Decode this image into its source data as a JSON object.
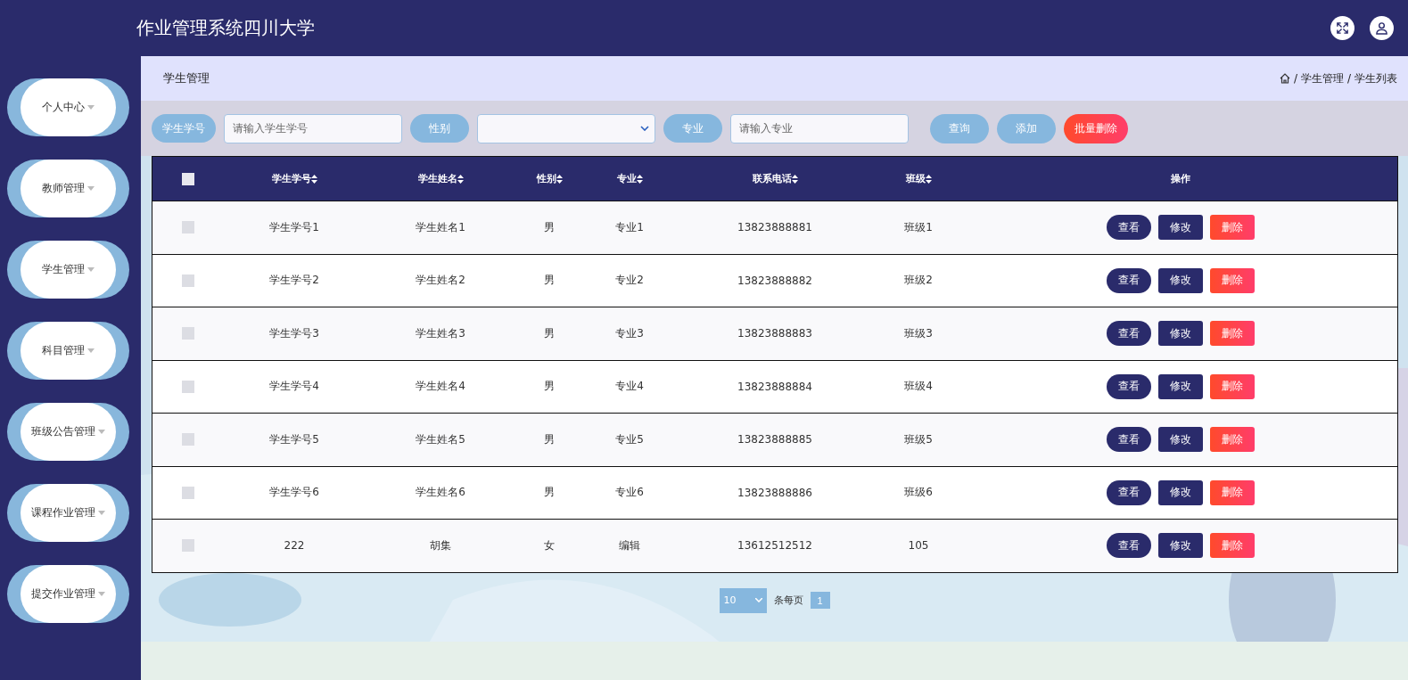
{
  "header": {
    "title": "作业管理系统四川大学"
  },
  "sidebar": {
    "items": [
      {
        "label": "个人中心",
        "expanded": false
      },
      {
        "label": "教师管理",
        "expanded": false
      },
      {
        "label": "学生管理",
        "expanded": false
      },
      {
        "label": "科目管理",
        "expanded": false
      },
      {
        "label": "班级公告管理",
        "expanded": false
      },
      {
        "label": "课程作业管理",
        "expanded": false
      },
      {
        "label": "提交作业管理",
        "expanded": false
      }
    ]
  },
  "page_title": "学生管理",
  "breadcrumb": [
    {
      "separator": "/",
      "label": "学生管理"
    },
    {
      "separator": "/",
      "label": "学生列表"
    }
  ],
  "search": {
    "fields": [
      {
        "kind": "input",
        "label": "学生学号",
        "placeholder": "请输入学生学号"
      },
      {
        "kind": "select",
        "label": "性别"
      },
      {
        "kind": "input",
        "label": "专业",
        "placeholder": "请输入专业"
      }
    ],
    "buttons": [
      {
        "label": "查询",
        "kind": "plain"
      },
      {
        "label": "添加",
        "kind": "plain"
      },
      {
        "label": "批量删除",
        "kind": "danger"
      }
    ]
  },
  "table": {
    "select_all_checked": false,
    "columns": [
      "学生学号",
      "学生姓名",
      "性别",
      "专业",
      "联系电话",
      "班级",
      "操作"
    ],
    "rows": [
      {
        "checked": false,
        "cells": [
          "学生学号1",
          "学生姓名1",
          "男",
          "专业1",
          "13823888881",
          "班级1"
        ],
        "actions": [
          {
            "label": "查看",
            "kind": "view"
          },
          {
            "label": "修改",
            "kind": "edit"
          },
          {
            "label": "删除",
            "kind": "delete"
          }
        ]
      },
      {
        "checked": false,
        "cells": [
          "学生学号2",
          "学生姓名2",
          "男",
          "专业2",
          "13823888882",
          "班级2"
        ],
        "actions": [
          {
            "label": "查看",
            "kind": "view"
          },
          {
            "label": "修改",
            "kind": "edit"
          },
          {
            "label": "删除",
            "kind": "delete"
          }
        ]
      },
      {
        "checked": false,
        "cells": [
          "学生学号3",
          "学生姓名3",
          "男",
          "专业3",
          "13823888883",
          "班级3"
        ],
        "actions": [
          {
            "label": "查看",
            "kind": "view"
          },
          {
            "label": "修改",
            "kind": "edit"
          },
          {
            "label": "删除",
            "kind": "delete"
          }
        ]
      },
      {
        "checked": false,
        "cells": [
          "学生学号4",
          "学生姓名4",
          "男",
          "专业4",
          "13823888884",
          "班级4"
        ],
        "actions": [
          {
            "label": "查看",
            "kind": "view"
          },
          {
            "label": "修改",
            "kind": "edit"
          },
          {
            "label": "删除",
            "kind": "delete"
          }
        ]
      },
      {
        "checked": false,
        "cells": [
          "学生学号5",
          "学生姓名5",
          "男",
          "专业5",
          "13823888885",
          "班级5"
        ],
        "actions": [
          {
            "label": "查看",
            "kind": "view"
          },
          {
            "label": "修改",
            "kind": "edit"
          },
          {
            "label": "删除",
            "kind": "delete"
          }
        ]
      },
      {
        "checked": false,
        "cells": [
          "学生学号6",
          "学生姓名6",
          "男",
          "专业6",
          "13823888886",
          "班级6"
        ],
        "actions": [
          {
            "label": "查看",
            "kind": "view"
          },
          {
            "label": "修改",
            "kind": "edit"
          },
          {
            "label": "删除",
            "kind": "delete"
          }
        ]
      },
      {
        "checked": false,
        "cells": [
          "222",
          "胡集",
          "女",
          "编辑",
          "13612512512",
          "105"
        ],
        "actions": [
          {
            "label": "查看",
            "kind": "view"
          },
          {
            "label": "修改",
            "kind": "edit"
          },
          {
            "label": "删除",
            "kind": "delete"
          }
        ]
      }
    ]
  },
  "pagination": {
    "page_size": "10",
    "per_page_label": "条每页",
    "pages": [
      {
        "label": "1",
        "selected": true
      }
    ]
  }
}
